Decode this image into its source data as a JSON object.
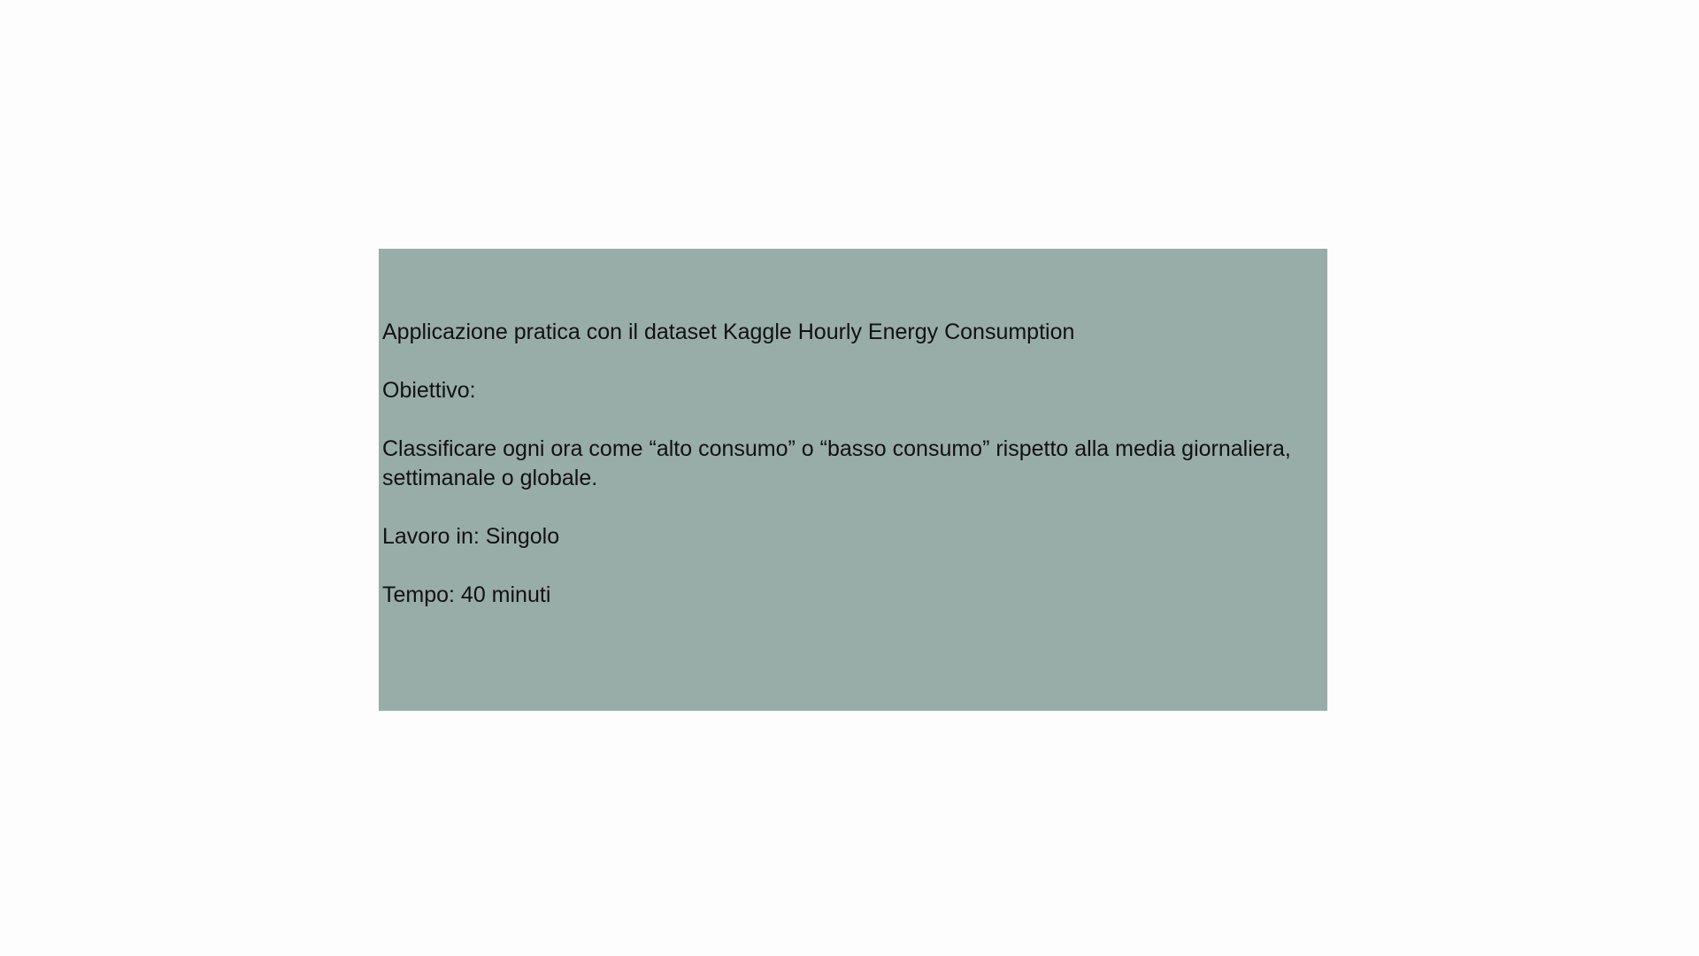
{
  "card": {
    "background_color": "#99ada8",
    "title": "Applicazione pratica con il dataset Kaggle Hourly Energy Consumption",
    "objective_label": "Obiettivo:",
    "objective_text": "Classificare ogni ora come “alto consumo” o “basso consumo” rispetto alla media giornaliera, settimanale o globale.",
    "work_mode": "Lavoro in: Singolo",
    "duration": "Tempo: 40 minuti"
  }
}
